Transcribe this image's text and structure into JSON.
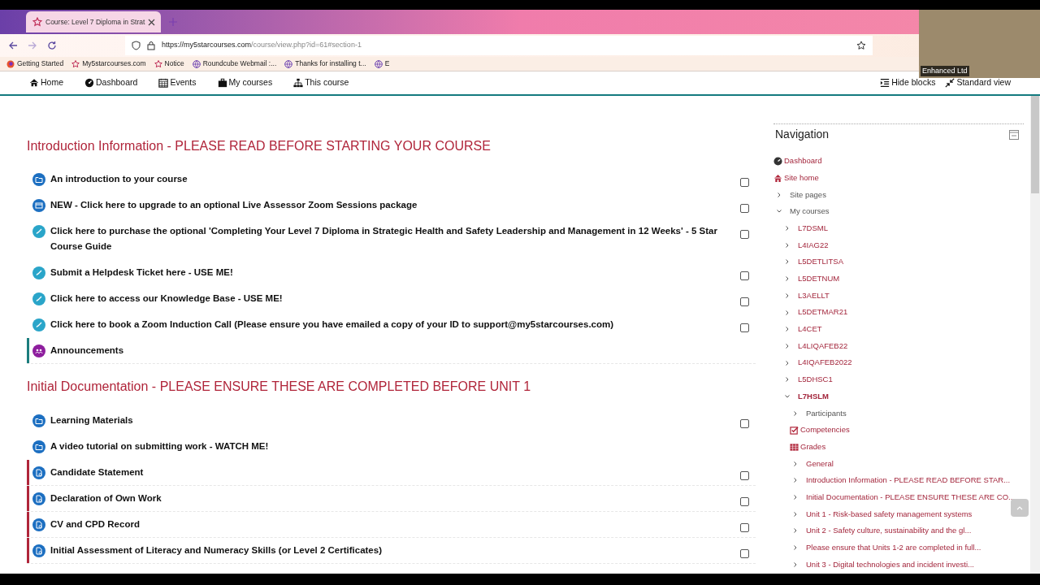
{
  "browser": {
    "tab_title": "Course: Level 7 Diploma in Strat",
    "url_host": "https://my5starcourses.com",
    "url_path": "/course/view.php?id=61#section-1",
    "bookmarks": [
      {
        "kind": "firefox",
        "label": "Getting Started"
      },
      {
        "kind": "star",
        "label": "My5starcourses.com"
      },
      {
        "kind": "star",
        "label": "Notice"
      },
      {
        "kind": "globe",
        "label": "Roundcube Webmail :..."
      },
      {
        "kind": "globe",
        "label": "Thanks for installing t..."
      },
      {
        "kind": "globe",
        "label": "E"
      }
    ]
  },
  "webcam": {
    "caption": "Enhanced Ltd"
  },
  "navbar": {
    "items": [
      {
        "kind": "home",
        "label": "Home"
      },
      {
        "kind": "dashboard",
        "label": "Dashboard"
      },
      {
        "kind": "calendar",
        "label": "Events"
      },
      {
        "kind": "briefcase",
        "label": "My courses"
      },
      {
        "kind": "sitemap",
        "label": "This course"
      }
    ],
    "right": [
      {
        "kind": "hide",
        "label": "Hide blocks"
      },
      {
        "kind": "compress",
        "label": "Standard view"
      }
    ]
  },
  "sections": [
    {
      "title": "Introduction Information - PLEASE READ BEFORE STARTING YOUR COURSE",
      "activities": [
        {
          "kind": "folder",
          "label": "An introduction to your course",
          "checked": false
        },
        {
          "kind": "page",
          "label": "NEW - Click here to upgrade to an optional Live Assessor Zoom Sessions package",
          "checked": false
        },
        {
          "kind": "url",
          "label": "Click here to purchase the optional 'Completing Your Level 7 Diploma in Strategic Health and Safety Leadership and Management in 12 Weeks' - 5 Star Course Guide",
          "checked": false
        },
        {
          "kind": "url",
          "label": "Submit a Helpdesk Ticket here - USE ME!",
          "checked": false
        },
        {
          "kind": "url",
          "label": "Click here to access our Knowledge Base - USE ME!",
          "checked": false
        },
        {
          "kind": "url",
          "label": "Click here to book a Zoom Induction Call (Please ensure you have emailed a copy of your ID to support@my5starcourses.com)",
          "checked": false
        },
        {
          "kind": "forum",
          "label": "Announcements",
          "color": "#1b7d7d"
        }
      ]
    },
    {
      "title": "Initial Documentation - PLEASE ENSURE THESE ARE COMPLETED BEFORE UNIT 1",
      "activities": [
        {
          "kind": "folder",
          "label": "Learning Materials",
          "checked": false
        },
        {
          "kind": "folder",
          "label": "A video tutorial on submitting work - WATCH ME!"
        },
        {
          "kind": "assign",
          "label": "Candidate Statement",
          "checked": false,
          "color": "#b0253a"
        },
        {
          "kind": "assign",
          "label": "Declaration of Own Work",
          "checked": false,
          "color": "#b0253a"
        },
        {
          "kind": "assign",
          "label": "CV and CPD Record",
          "checked": false,
          "color": "#b0253a"
        },
        {
          "kind": "assign",
          "label": "Initial Assessment of Literacy and Numeracy Skills (or Level 2 Certificates)",
          "checked": false,
          "color": "#b0253a"
        }
      ]
    }
  ],
  "navigation": {
    "title": "Navigation",
    "items": [
      {
        "kind": "dashboard",
        "label": "Dashboard",
        "link": true
      },
      {
        "kind": "home",
        "label": "Site home",
        "link": true
      },
      {
        "kind": "branch",
        "label": "Site pages",
        "link": false,
        "expanded": false
      },
      {
        "kind": "branch",
        "label": "My courses",
        "link": false,
        "expanded": true,
        "children": [
          {
            "kind": "branch",
            "label": "L7DSML",
            "link": true,
            "expanded": false
          },
          {
            "kind": "branch",
            "label": "L4IAG22",
            "link": true,
            "expanded": false
          },
          {
            "kind": "branch",
            "label": "L5DETLITSA",
            "link": true,
            "expanded": false
          },
          {
            "kind": "branch",
            "label": "L5DETNUM",
            "link": true,
            "expanded": false
          },
          {
            "kind": "branch",
            "label": "L3AELLT",
            "link": true,
            "expanded": false
          },
          {
            "kind": "branch",
            "label": "L5DETMAR21",
            "link": true,
            "expanded": false
          },
          {
            "kind": "branch",
            "label": "L4CET",
            "link": true,
            "expanded": false
          },
          {
            "kind": "branch",
            "label": "L4LIQAFEB22",
            "link": true,
            "expanded": false
          },
          {
            "kind": "branch",
            "label": "L4IQAFEB2022",
            "link": true,
            "expanded": false
          },
          {
            "kind": "branch",
            "label": "L5DHSC1",
            "link": true,
            "expanded": false
          },
          {
            "kind": "branch",
            "label": "L7HSLM",
            "link": true,
            "expanded": true,
            "current": true,
            "children": [
              {
                "kind": "branch",
                "label": "Participants",
                "link": false,
                "expanded": false
              },
              {
                "kind": "competencies",
                "label": "Competencies",
                "link": true
              },
              {
                "kind": "grades",
                "label": "Grades",
                "link": true
              },
              {
                "kind": "branch",
                "label": "General",
                "link": true,
                "expanded": false
              },
              {
                "kind": "branch",
                "label": "Introduction Information - PLEASE READ BEFORE STAR...",
                "link": true,
                "expanded": false
              },
              {
                "kind": "branch",
                "label": "Initial Documentation - PLEASE ENSURE THESE ARE CO...",
                "link": true,
                "expanded": false
              },
              {
                "kind": "branch",
                "label": "Unit 1 - Risk-based safety management systems",
                "link": true,
                "expanded": false
              },
              {
                "kind": "branch",
                "label": "Unit 2 - Safety culture, sustainability and the gl...",
                "link": true,
                "expanded": false
              },
              {
                "kind": "branch",
                "label": "Please ensure that Units 1-2 are completed in full...",
                "link": true,
                "expanded": false
              },
              {
                "kind": "branch",
                "label": "Unit 3 - Digital technologies and incident investi...",
                "link": true,
                "expanded": false
              }
            ]
          }
        ]
      }
    ]
  }
}
